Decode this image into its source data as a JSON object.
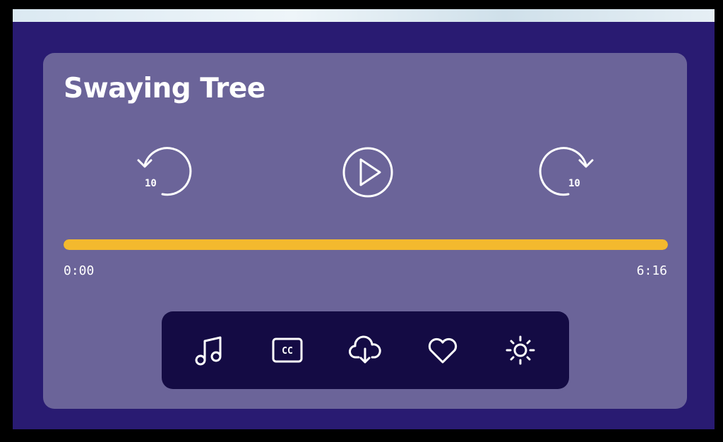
{
  "player": {
    "title": "Swaying Tree",
    "rewind_seconds": "10",
    "forward_seconds": "10",
    "current_time": "0:00",
    "total_time": "6:16",
    "progress_fraction": 1.0
  },
  "toolbar": {
    "items": [
      {
        "icon": "music-note-icon"
      },
      {
        "icon": "closed-captions-icon",
        "label": "CC"
      },
      {
        "icon": "cloud-download-icon"
      },
      {
        "icon": "heart-icon"
      },
      {
        "icon": "brightness-icon"
      }
    ]
  },
  "colors": {
    "background": "#291b72",
    "card": "#6b6499",
    "toolbar": "#140b44",
    "progress": "#f3b92e",
    "foreground": "#ffffff"
  }
}
